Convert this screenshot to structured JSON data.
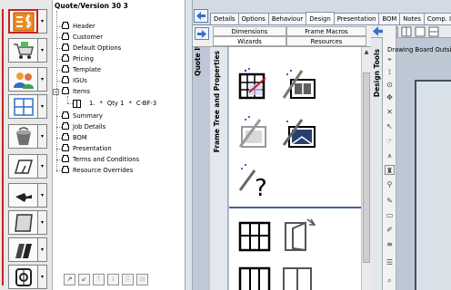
{
  "tree": {
    "title": "Quote/Version 30 3",
    "items": [
      {
        "label": "Header"
      },
      {
        "label": "Customer"
      },
      {
        "label": "Default Options"
      },
      {
        "label": "Pricing"
      },
      {
        "label": "Template"
      },
      {
        "label": "IGUs"
      },
      {
        "label": "Items"
      },
      {
        "label": "Summary"
      },
      {
        "label": "Job Details"
      },
      {
        "label": "BOM"
      },
      {
        "label": "Presentation"
      },
      {
        "label": "Terms and Conditions"
      },
      {
        "label": "Resource Overrides"
      }
    ],
    "line_item": {
      "index": "1.",
      "qty": "Qty 1",
      "code": "C-BF-3"
    },
    "expander_open": "−"
  },
  "vertical_tabs": {
    "quote_items": "Quote Items",
    "frame_tree": "Frame Tree and Properties",
    "design_tools": "Design Tools"
  },
  "tabs": [
    {
      "label": "Details"
    },
    {
      "label": "Options"
    },
    {
      "label": "Behaviour"
    },
    {
      "label": "Design",
      "active": true
    },
    {
      "label": "Presentation"
    },
    {
      "label": "BOM"
    },
    {
      "label": "Notes"
    },
    {
      "label": "Comp. I"
    }
  ],
  "subtabs": {
    "dimensions": "Dimensions",
    "frame_macros": "Frame Macros",
    "wizards": "Wizards",
    "resources": "Resources"
  },
  "board": {
    "title": "Drawing Board Outsi"
  },
  "colors": {
    "accent": "#cc2020",
    "nav": "#3a6ec8",
    "selection": "#4060a0"
  }
}
